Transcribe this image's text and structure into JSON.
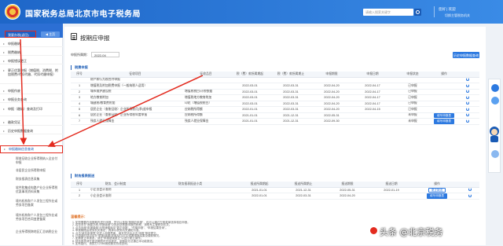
{
  "header": {
    "title": "国家税务总局北京市电子税务局",
    "search_placeholder": "请输入搜索关键字",
    "welcome": "您好 | 欢迎",
    "user_sub": "切换主管税务机关"
  },
  "sidebar": {
    "primary_button": "我要办税(返回)",
    "home_button": "◀ 主页",
    "items": [
      {
        "label": "申报缴纳"
      },
      {
        "label": "税费缴纳"
      },
      {
        "label": "申报错误更正"
      },
      {
        "label": "更正优惠申报（增值税、消费税、附加税费/代扣代缴、代扣代缴申报）"
      },
      {
        "label": "申报作废"
      },
      {
        "label": "申报业务查询"
      },
      {
        "label": "申报（缴纳）查询及打印"
      },
      {
        "label": "缴款凭证"
      },
      {
        "label": "历史申报数据查询"
      },
      {
        "label": "申报缴纳信息查询"
      }
    ],
    "sub_items": [
      {
        "label": "税收征收企业所得税纳入全支付申报"
      },
      {
        "label": "非居民企业所得税申报"
      },
      {
        "label": "财务报表信息采集"
      },
      {
        "label": "软件和集成电路产业企业所得税优惠事项资料采集"
      },
      {
        "label": "境内机构和个人发包工程作业或劳务项目备案"
      },
      {
        "label": "境外机构和个人发包工程作业或劳务项目合同变更备案"
      },
      {
        "label": "企业所得税跨地区汇总纳税企业"
      }
    ]
  },
  "main": {
    "title": "按期应申报",
    "period_label": "申报所属期：",
    "period_value": "2022-04",
    "history_button": "历史申报数据查询",
    "section1": "税费申报",
    "table1": {
      "headers": [
        "序号",
        "征收项目",
        "征收品目",
        "税（费）款所属期起",
        "税（费）款所属期止",
        "申报期限",
        "申报日期",
        "申报状态",
        "操作"
      ],
      "rows": [
        {
          "no": "",
          "item": "财产和行为税合并申报",
          "sub": "",
          "start": "",
          "end": "",
          "deadline": "",
          "date": "",
          "status": "",
          "op": "",
          "refresh": true
        },
        {
          "no": "1",
          "item": "增值税及附加税费申报（一般纳税人适用）",
          "sub": "",
          "start": "2022-03-01",
          "end": "2022-03-31",
          "deadline": "2022-04-20",
          "date": "2022-04-17",
          "status": "已申报",
          "op": "",
          "refresh": true
        },
        {
          "no": "2",
          "item": "城市维护建设税",
          "sub": "增值税税目/计税依据",
          "start": "2022-03-01",
          "end": "2022-03-31",
          "deadline": "2022-04-20",
          "date": "2022-04-17",
          "status": "已申报",
          "op": "",
          "refresh": true
        },
        {
          "no": "3",
          "item": "地方教育附加",
          "sub": "增值税地方教育附加",
          "start": "2022-03-01",
          "end": "2022-03-31",
          "deadline": "2022-04-20",
          "date": "2022-04-17",
          "status": "已申报",
          "op": "",
          "refresh": true
        },
        {
          "no": "4",
          "item": "城建税/教育费附加",
          "sub": "印花（增值税税目）",
          "start": "2022-03-01",
          "end": "2022-03-31",
          "deadline": "2022-04-20",
          "date": "2022-04-17",
          "status": "已申报",
          "op": "",
          "refresh": true
        },
        {
          "no": "5",
          "item": "居民企业（查账征收）企业所得税月(季)度申报",
          "sub": "应纳税所得额",
          "start": "2022-01-01",
          "end": "2022-03-31",
          "deadline": "2022-04-20",
          "date": "2022-04-15",
          "status": "已申报",
          "op": "",
          "refresh": true
        },
        {
          "no": "6",
          "item": "居民企业（查账征收）企业所得税年度申报",
          "sub": "应纳税所得额",
          "start": "2021-01-01",
          "end": "2021-12-31",
          "deadline": "2022-05-31",
          "date": "",
          "status": "未申报",
          "op": "填写申报表",
          "refresh": true
        },
        {
          "no": "7",
          "item": "残疾人就业保障金",
          "sub": "残疾人就业保障金",
          "start": "2021-01-01",
          "end": "2021-12-31",
          "deadline": "2022-09-30",
          "date": "",
          "status": "未申报",
          "op": "填写申报表",
          "refresh": true
        }
      ]
    },
    "section2": "财务报表报送",
    "table2": {
      "headers": [
        "序号",
        "财务、会计制度",
        "财务报表报送小类",
        "报送所属期起",
        "报送所属期止",
        "报送期限",
        "报送日期",
        "操作"
      ],
      "rows": [
        {
          "no": "1",
          "system": "小企业会计准则",
          "sub": "",
          "start": "2021-01-01",
          "end": "2021-12-31",
          "deadline": "2022-05-31",
          "date": "2022-01-19",
          "op": "更正报送"
        },
        {
          "no": "2",
          "system": "小企业会计准则",
          "sub": "",
          "start": "2022-01-01",
          "end": "2022-03-31",
          "deadline": "2022-04-20",
          "date": "",
          "op": "填写申报表"
        }
      ]
    },
    "notes_title": "温馨提示：",
    "notes": [
      "1. 如您需要在申报期内进行申报，您可以选择“按期应申报”，也可以通过左侧菜单选择相应申报。",
      "2. 若您未在“我要办税-申报缴纳”中找到您需要申报的税种，请联系主管税务机关。",
      "3. 点击页面“申报缴纳”可快速跳转至“更正申报”、“作废申报”、“申报结果查询”。",
      "4. 申报期限由税务机关核定，具体以税务机关通知为准。",
      "5. 点击“填写申报表”可进入申报界面，填写完毕后点击“申报”按钮提交。",
      "6. 已申报的项目可在“申报(缴纳)查询及打印”中查看申报结果及缴款情况。",
      "7. 如需更正申报表，请在“申报错误更正”中进行更正操作。",
      "8. 财务报表请在报送期限内完成报送，逾期将无法通过本功能报送。",
      "9. 如有疑问，请拨打12366纳税服务热线咨询。"
    ]
  },
  "watermark": "头条 @北京税务",
  "colors": {
    "header_blue": "#2c6fd4",
    "highlight_red": "#e32b1f",
    "link_blue": "#2c79e0"
  }
}
